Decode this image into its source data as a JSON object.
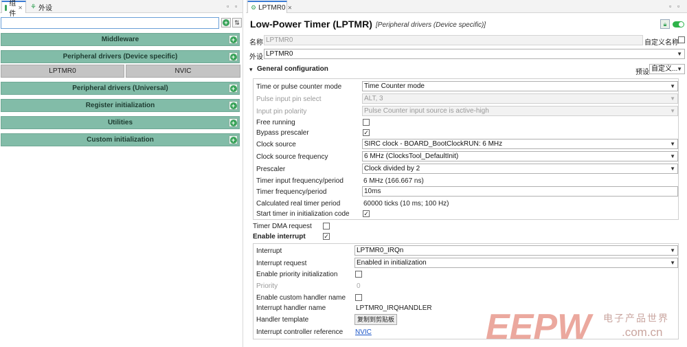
{
  "left_panel": {
    "tabs": [
      {
        "label": "组件"
      },
      {
        "label": "外设"
      }
    ],
    "categories": [
      {
        "label": "Middleware"
      },
      {
        "label": "Peripheral drivers (Device specific)"
      },
      {
        "label": "Peripheral drivers (Universal)"
      },
      {
        "label": "Register initialization"
      },
      {
        "label": "Utilities"
      },
      {
        "label": "Custom initialization"
      }
    ],
    "components": [
      {
        "label": "LPTMR0"
      },
      {
        "label": "NVIC"
      }
    ]
  },
  "right_panel": {
    "tab_label": "LPTMR0",
    "title": "Low-Power Timer (LPTMR)",
    "subtitle": "[Peripheral drivers (Device specific)]",
    "name_label": "名称",
    "name_value": "LPTMR0",
    "custom_name_label": "自定义名称",
    "peripheral_label": "外设",
    "peripheral_value": "LPTMR0",
    "general_config_label": "General configuration",
    "preset_label": "预设",
    "preset_value": "自定义...",
    "general": {
      "mode_label": "Time or pulse counter mode",
      "mode_value": "Time Counter mode",
      "pin_select_label": "Pulse input pin select",
      "pin_select_value": "ALT, 3",
      "pin_polarity_label": "Input pin polarity",
      "pin_polarity_value": "Pulse Counter input source is active-high",
      "free_running_label": "Free running",
      "bypass_label": "Bypass prescaler",
      "clock_source_label": "Clock source",
      "clock_source_value": "SIRC clock - BOARD_BootClockRUN: 6 MHz",
      "clock_freq_label": "Clock source frequency",
      "clock_freq_value": "6 MHz (ClocksTool_DefaultInit)",
      "prescaler_label": "Prescaler",
      "prescaler_value": "Clock divided by 2",
      "input_freq_label": "Timer input frequency/period",
      "input_freq_value": "6 MHz (166.667 ns)",
      "timer_freq_label": "Timer frequency/period",
      "timer_freq_value": "10ms",
      "calc_period_label": "Calculated real timer period",
      "calc_period_value": "60000 ticks (10 ms; 100 Hz)",
      "start_timer_label": "Start timer in initialization code"
    },
    "dma_label": "Timer DMA request",
    "enable_interrupt_label": "Enable interrupt",
    "interrupt": {
      "interrupt_label": "Interrupt",
      "interrupt_value": "LPTMR0_IRQn",
      "request_label": "Interrupt request",
      "request_value": "Enabled in initialization",
      "priority_init_label": "Enable priority initialization",
      "priority_label": "Priority",
      "priority_value": "0",
      "custom_handler_label": "Enable custom handler name",
      "handler_name_label": "Interrupt handler name",
      "handler_name_value": "LPTMR0_IRQHANDLER",
      "handler_template_label": "Handler template",
      "copy_button_label": "复制到剪贴板",
      "controller_ref_label": "Interrupt controller reference",
      "controller_ref_value": "NVIC"
    }
  },
  "watermark": {
    "logo_text": "EEPW",
    "cn_text": "电子产品世界",
    "url": ".com.cn"
  },
  "colors": {
    "category_bg": "#82bca8",
    "toggle_green": "#2fb34a",
    "link_blue": "#1a55c8"
  }
}
